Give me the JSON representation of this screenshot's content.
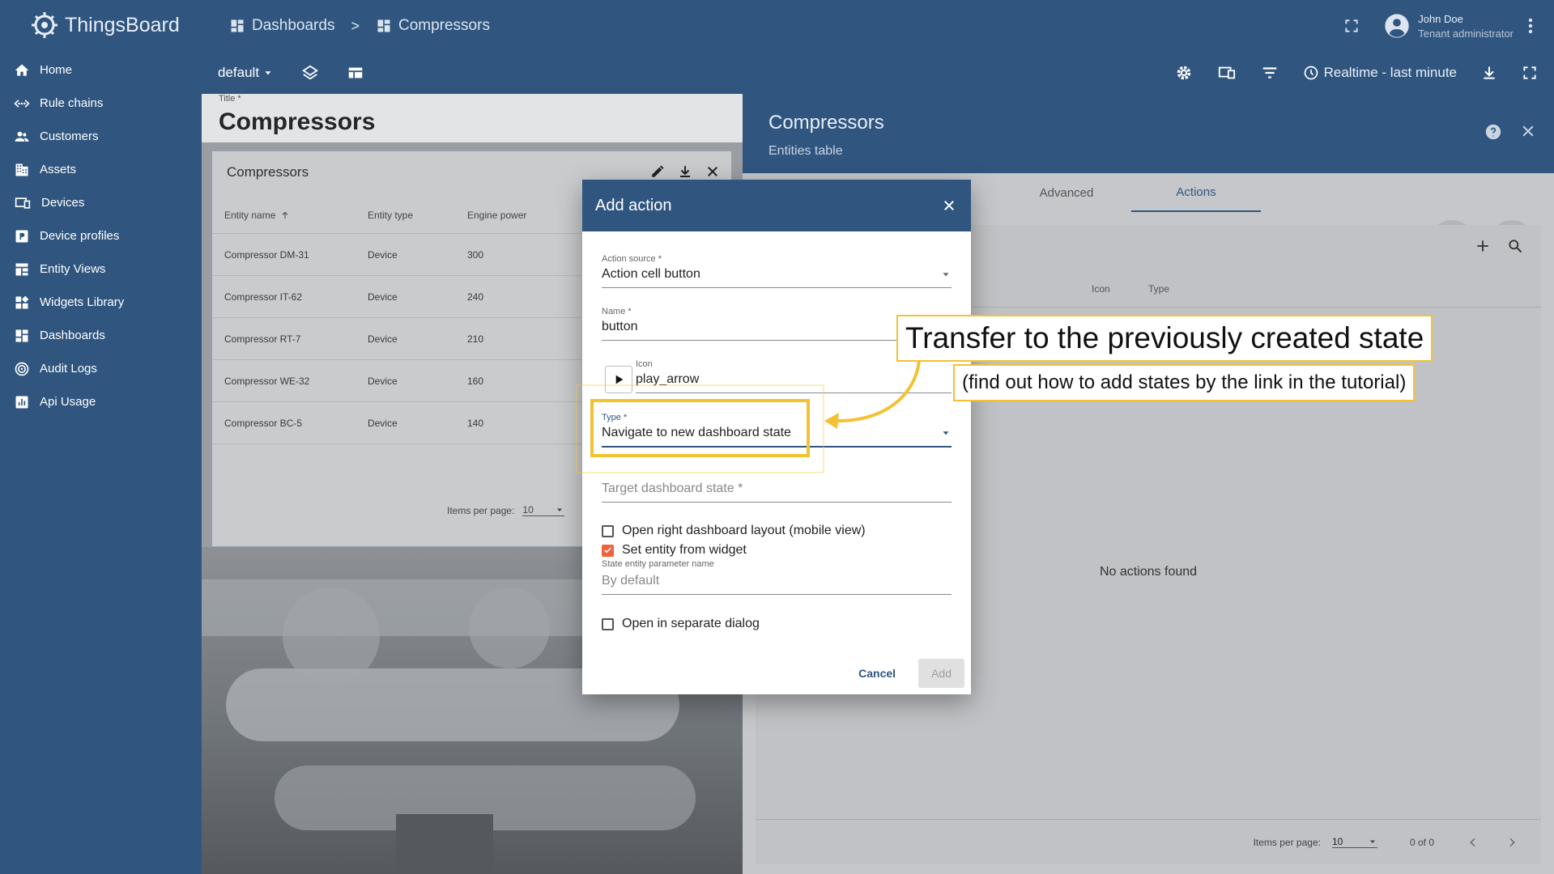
{
  "app": {
    "name": "ThingsBoard"
  },
  "sidebar": {
    "items": [
      {
        "label": "Home",
        "icon": "home-icon"
      },
      {
        "label": "Rule chains",
        "icon": "rule-chains-icon"
      },
      {
        "label": "Customers",
        "icon": "customers-icon"
      },
      {
        "label": "Assets",
        "icon": "assets-icon"
      },
      {
        "label": "Devices",
        "icon": "devices-icon"
      },
      {
        "label": "Device profiles",
        "icon": "device-profiles-icon"
      },
      {
        "label": "Entity Views",
        "icon": "entity-views-icon"
      },
      {
        "label": "Widgets Library",
        "icon": "widgets-library-icon"
      },
      {
        "label": "Dashboards",
        "icon": "dashboards-icon"
      },
      {
        "label": "Audit Logs",
        "icon": "audit-logs-icon"
      },
      {
        "label": "Api Usage",
        "icon": "api-usage-icon"
      }
    ]
  },
  "header": {
    "breadcrumb": [
      "Dashboards",
      "Compressors"
    ],
    "separator": ">",
    "user_name": "John Doe",
    "user_role": "Tenant administrator"
  },
  "toolbar": {
    "state": "default",
    "timewindow": "Realtime - last minute"
  },
  "dashboard": {
    "title_label": "Title *",
    "title": "Compressors",
    "widget": {
      "title": "Compressors",
      "columns": [
        "Entity name",
        "Entity type",
        "Engine power"
      ],
      "rows": [
        [
          "Compressor DM-31",
          "Device",
          "300"
        ],
        [
          "Compressor IT-62",
          "Device",
          "240"
        ],
        [
          "Compressor RT-7",
          "Device",
          "210"
        ],
        [
          "Compressor WE-32",
          "Device",
          "160"
        ],
        [
          "Compressor BC-5",
          "Device",
          "140"
        ]
      ],
      "items_per_page_label": "Items per page:",
      "items_per_page": "10"
    }
  },
  "panel": {
    "title": "Compressors",
    "subtitle": "Entities table",
    "tabs": [
      "Advanced",
      "Actions"
    ],
    "active_tab": "Actions",
    "columns": [
      "Icon",
      "Type"
    ],
    "empty_text": "No actions found",
    "items_per_page_label": "Items per page:",
    "items_per_page": "10",
    "range": "0 of 0"
  },
  "dialog": {
    "title": "Add action",
    "action_source_label": "Action source *",
    "action_source": "Action cell button",
    "name_label": "Name *",
    "name": "button",
    "icon_label": "Icon",
    "icon_value": "play_arrow",
    "type_label": "Type *",
    "type_value": "Navigate to new dashboard state",
    "target_state_placeholder": "Target dashboard state *",
    "open_right_layout": "Open right dashboard layout (mobile view)",
    "set_entity": "Set entity from widget",
    "state_param_label": "State entity parameter name",
    "state_param_placeholder": "By default",
    "open_dialog": "Open in separate dialog",
    "checkbox_states": {
      "open_right_layout": false,
      "set_entity": true,
      "open_dialog": false
    },
    "cancel": "Cancel",
    "add": "Add"
  },
  "annotations": {
    "main": "Transfer to the previously created state",
    "sub": "(find out how to add states by the link in the tutorial)",
    "color": "#f3c233"
  },
  "colors": {
    "primary": "#305680",
    "accent": "#f0643c"
  }
}
